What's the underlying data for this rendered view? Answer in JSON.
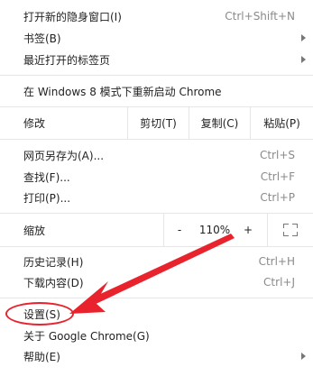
{
  "menu": {
    "incognito": {
      "label": "打开新的隐身窗口(I)",
      "shortcut": "Ctrl+Shift+N"
    },
    "bookmarks": {
      "label": "书签(B)"
    },
    "recent_tabs": {
      "label": "最近打开的标签页"
    },
    "relaunch": {
      "label": "在 Windows 8 模式下重新启动 Chrome"
    },
    "edit": {
      "label": "修改",
      "cut": "剪切(T)",
      "copy": "复制(C)",
      "paste": "粘贴(P)"
    },
    "save_page": {
      "label": "网页另存为(A)...",
      "shortcut": "Ctrl+S"
    },
    "find": {
      "label": "查找(F)...",
      "shortcut": "Ctrl+F"
    },
    "print": {
      "label": "打印(P)...",
      "shortcut": "Ctrl+P"
    },
    "zoom": {
      "label": "缩放",
      "minus": "-",
      "level": "110%",
      "plus": "+"
    },
    "history": {
      "label": "历史记录(H)",
      "shortcut": "Ctrl+H"
    },
    "downloads": {
      "label": "下载内容(D)",
      "shortcut": "Ctrl+J"
    },
    "settings": {
      "label": "设置(S)"
    },
    "about": {
      "label": "关于 Google Chrome(G)"
    },
    "help": {
      "label": "帮助(E)"
    }
  },
  "colors": {
    "highlight": "#e8232d"
  }
}
